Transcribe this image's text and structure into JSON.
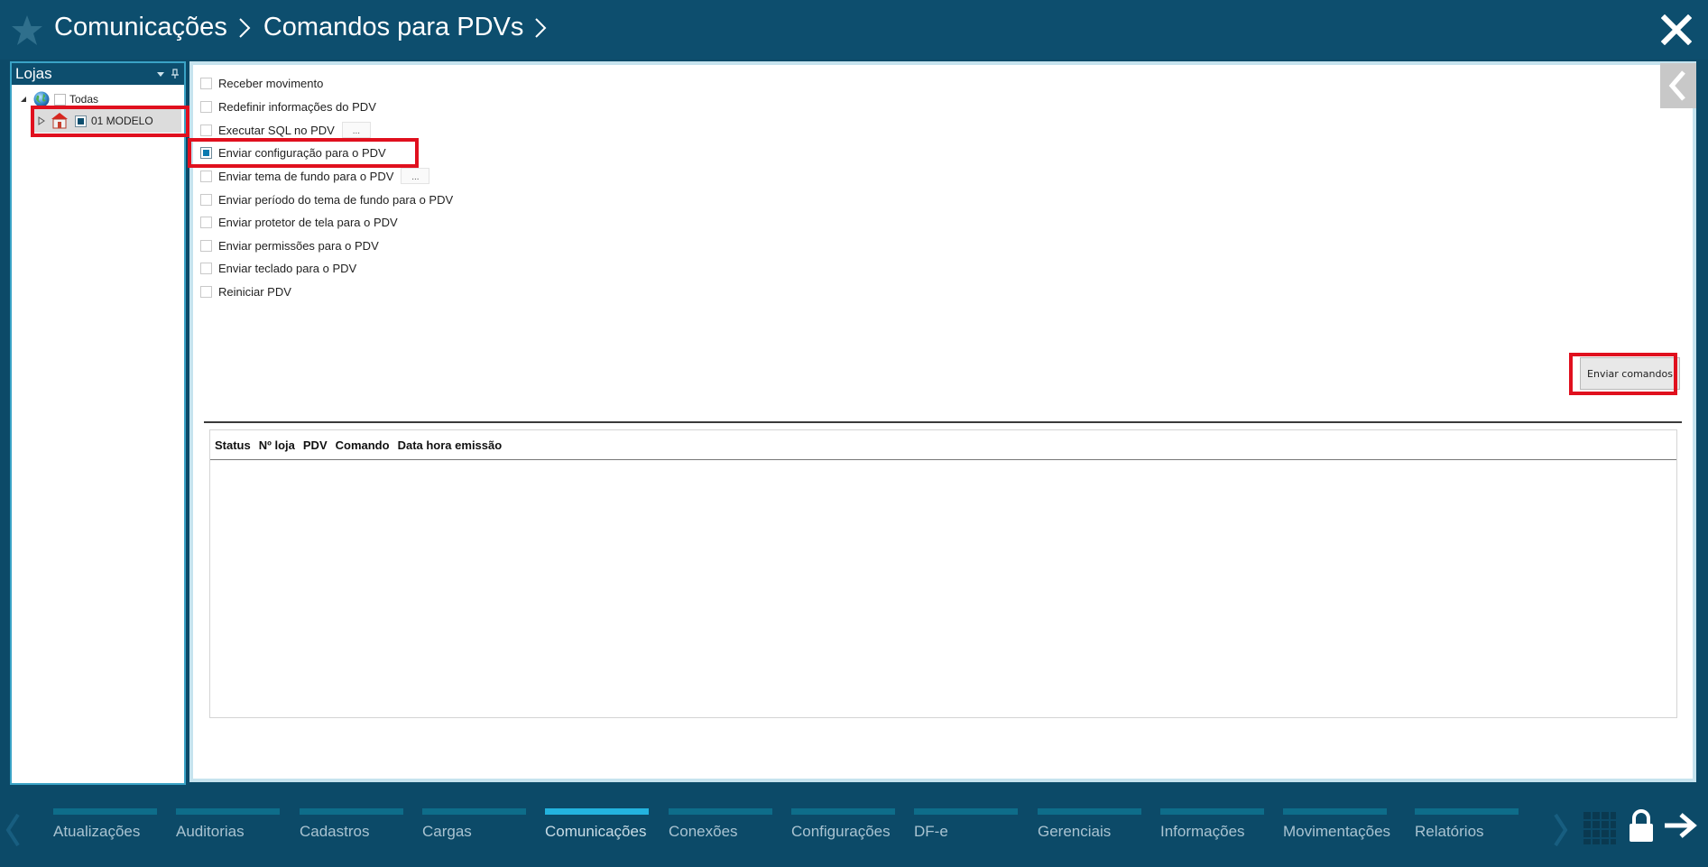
{
  "titlebar": {
    "breadcrumb": [
      "Comunicações",
      "Comandos para PDVs"
    ]
  },
  "stores_panel": {
    "title": "Lojas",
    "tree": [
      {
        "label": "Todas",
        "checked": false,
        "icon": "globe-icon"
      },
      {
        "label": "01 MODELO",
        "checked": true,
        "icon": "house-icon"
      }
    ]
  },
  "commands": {
    "items": [
      {
        "label": "Receber movimento",
        "checked": false
      },
      {
        "label": "Redefinir informações do PDV",
        "checked": false
      },
      {
        "label": "Executar SQL no PDV",
        "checked": false,
        "has_dots_button": true
      },
      {
        "label": "Enviar configuração para o PDV",
        "checked": true
      },
      {
        "label": "Enviar tema de fundo para o PDV",
        "checked": false,
        "has_dots_button": true
      },
      {
        "label": "Enviar período do tema de fundo para o PDV",
        "checked": false
      },
      {
        "label": "Enviar protetor de tela para o PDV",
        "checked": false
      },
      {
        "label": "Enviar permissões para o PDV",
        "checked": false
      },
      {
        "label": "Enviar teclado para o PDV",
        "checked": false
      },
      {
        "label": "Reiniciar PDV",
        "checked": false
      }
    ],
    "dots_label": "...",
    "send_button_label": "Enviar comandos"
  },
  "grid": {
    "columns": [
      "Status",
      "Nº loja",
      "PDV",
      "Comando",
      "Data hora emissão"
    ],
    "rows": []
  },
  "bottom_nav": {
    "tabs": [
      {
        "label": "Atualizações",
        "active": false
      },
      {
        "label": "Auditorias",
        "active": false
      },
      {
        "label": "Cadastros",
        "active": false
      },
      {
        "label": "Cargas",
        "active": false
      },
      {
        "label": "Comunicações",
        "active": true
      },
      {
        "label": "Conexões",
        "active": false
      },
      {
        "label": "Configurações",
        "active": false
      },
      {
        "label": "DF-e",
        "active": false
      },
      {
        "label": "Gerenciais",
        "active": false
      },
      {
        "label": "Informações",
        "active": false
      },
      {
        "label": "Movimentações",
        "active": false
      },
      {
        "label": "Relatórios",
        "active": false
      }
    ]
  },
  "colors": {
    "header_bg": "#0d4e6e",
    "nav_bar": "#0e6d8a",
    "nav_bar_active": "#23b3df",
    "highlight": "#e0101e",
    "panel_border": "#3aa3c6"
  }
}
